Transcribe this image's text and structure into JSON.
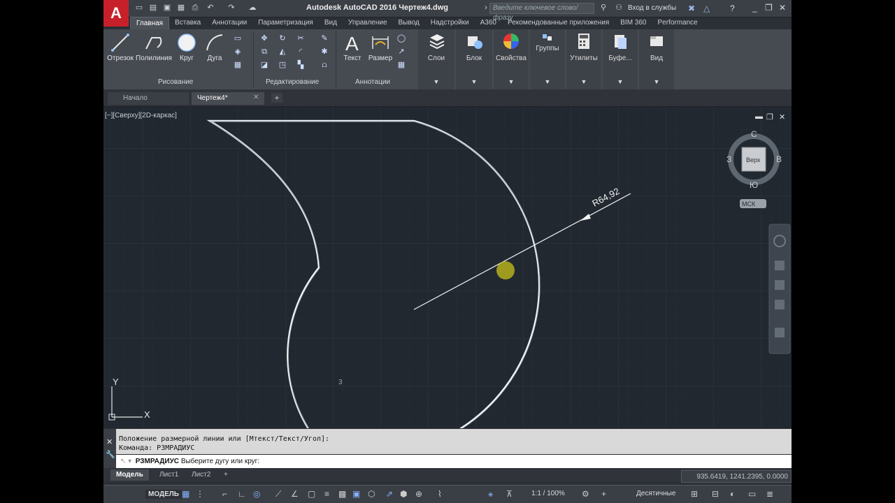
{
  "titlebar": {
    "title": "Autodesk AutoCAD 2016   Чертеж4.dwg",
    "search_placeholder": "Введите ключевое слово/фразу",
    "signin": "Вход в службы"
  },
  "ribbon_tabs": [
    "Главная",
    "Вставка",
    "Аннотации",
    "Параметризация",
    "Вид",
    "Управление",
    "Вывод",
    "Надстройки",
    "A360",
    "Рекомендованные приложения",
    "BIM 360",
    "Performance"
  ],
  "ribbon": {
    "draw": {
      "line": "Отрезок",
      "polyline": "Полилиния",
      "circle": "Круг",
      "arc": "Дуга",
      "panel": "Рисование"
    },
    "modify": {
      "panel": "Редактирование"
    },
    "annotate": {
      "text": "Текст",
      "dimension": "Размер",
      "panel": "Аннотации"
    },
    "layers": "Слои",
    "block": "Блок",
    "properties": "Свойства",
    "groups": "Группы",
    "utilities": "Утилиты",
    "clipboard": "Буфе...",
    "view": "Вид"
  },
  "file_tabs": {
    "start": "Начало",
    "drawing": "Чертеж4*"
  },
  "viewport": {
    "label": "[−][Сверху][2D-каркас]",
    "dimension_text": "R64,92",
    "compass": {
      "n": "С",
      "s": "Ю",
      "w": "З",
      "e": "В",
      "cube": "Верх"
    },
    "ucs_menu": "МСК",
    "axis_x": "X",
    "axis_y": "Y"
  },
  "command": {
    "history": [
      "Положение размерной линии или [Мтекст/Текст/Угол]:",
      "Команда: РЗМРАДИУС"
    ],
    "current_cmd": "РЗМРАДИУС",
    "prompt": "Выберите дугу или круг:"
  },
  "layout_tabs": [
    "Модель",
    "Лист1",
    "Лист2"
  ],
  "coords": "935.6419, 1241.2395, 0.0000",
  "status": {
    "model": "МОДЕЛЬ",
    "scale": "1:1 / 100%",
    "units": "Десятичные"
  }
}
